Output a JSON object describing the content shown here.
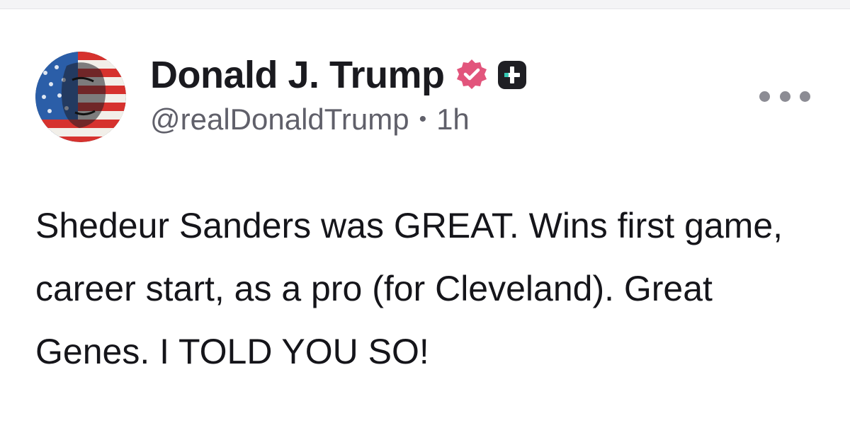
{
  "post": {
    "author": {
      "display_name": "Donald J. Trump",
      "handle": "@realDonaldTrump",
      "separator": "•",
      "time_ago": "1h",
      "verified_badge_icon": "verified-check-icon",
      "plus_badge_icon": "plus-square-icon"
    },
    "more_icon": "more-horizontal-icon",
    "body_text": "Shedeur Sanders was GREAT. Wins first game, career start, as a pro (for Cleveland). Great Genes. I TOLD YOU SO!"
  },
  "colors": {
    "verified_badge": "#e2557c",
    "plus_badge": "#1f1f24",
    "plus_badge_accent": "#35c9b4",
    "text_primary": "#15151a",
    "text_secondary": "#60606a"
  }
}
